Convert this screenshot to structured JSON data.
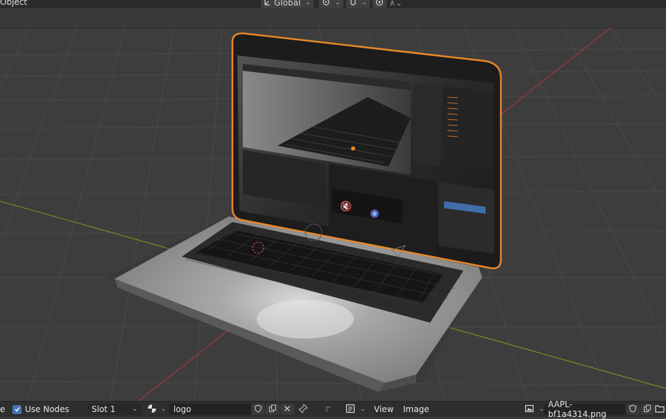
{
  "header": {
    "mode_label": "Object",
    "transform_orientation": "Global"
  },
  "bottom_bar": {
    "left_partial": "e",
    "use_nodes_label": "Use Nodes",
    "use_nodes_checked": true,
    "slot_value": "Slot 1",
    "material_name": "logo",
    "view_menu": "View",
    "image_menu": "Image",
    "image_name": "AAPL-bf1a4314.png"
  },
  "colors": {
    "selection_outline": "#e8892a",
    "grid_x_axis": "#a0383c",
    "grid_y_axis": "#6b8e23",
    "checkbox_accent": "#4772b3"
  },
  "icons": [
    "orientation-icon",
    "pivot-icon",
    "snap-icon",
    "proportional-icon",
    "browse-material-icon",
    "fake-user-icon",
    "duplicate-icon",
    "unlink-icon",
    "pin-icon",
    "image-browse-icon"
  ]
}
